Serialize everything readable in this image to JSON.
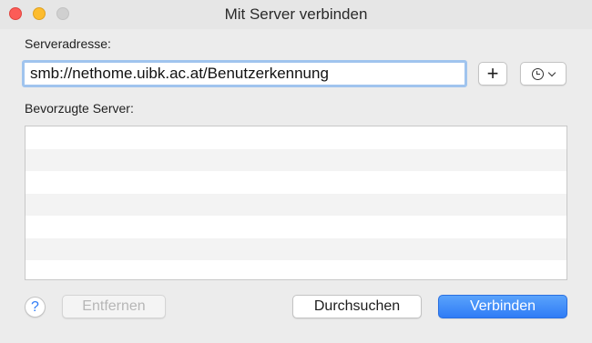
{
  "window": {
    "title": "Mit Server verbinden"
  },
  "address": {
    "label": "Serveradresse:",
    "value": "smb://nethome.uibk.ac.at/Benutzerkennung"
  },
  "toolbar": {
    "add_label": "+",
    "recent_icon": "clock-icon",
    "recent_chevron": "chevron-down-icon"
  },
  "favorites": {
    "label": "Bevorzugte Server:",
    "items": []
  },
  "buttons": {
    "help": "?",
    "remove": "Entfernen",
    "browse": "Durchsuchen",
    "connect": "Verbinden"
  },
  "colors": {
    "accent": "#2f7cf6",
    "focus_ring": "#a0c4ee",
    "close": "#fc5c57",
    "minimize": "#fdbc2e"
  }
}
